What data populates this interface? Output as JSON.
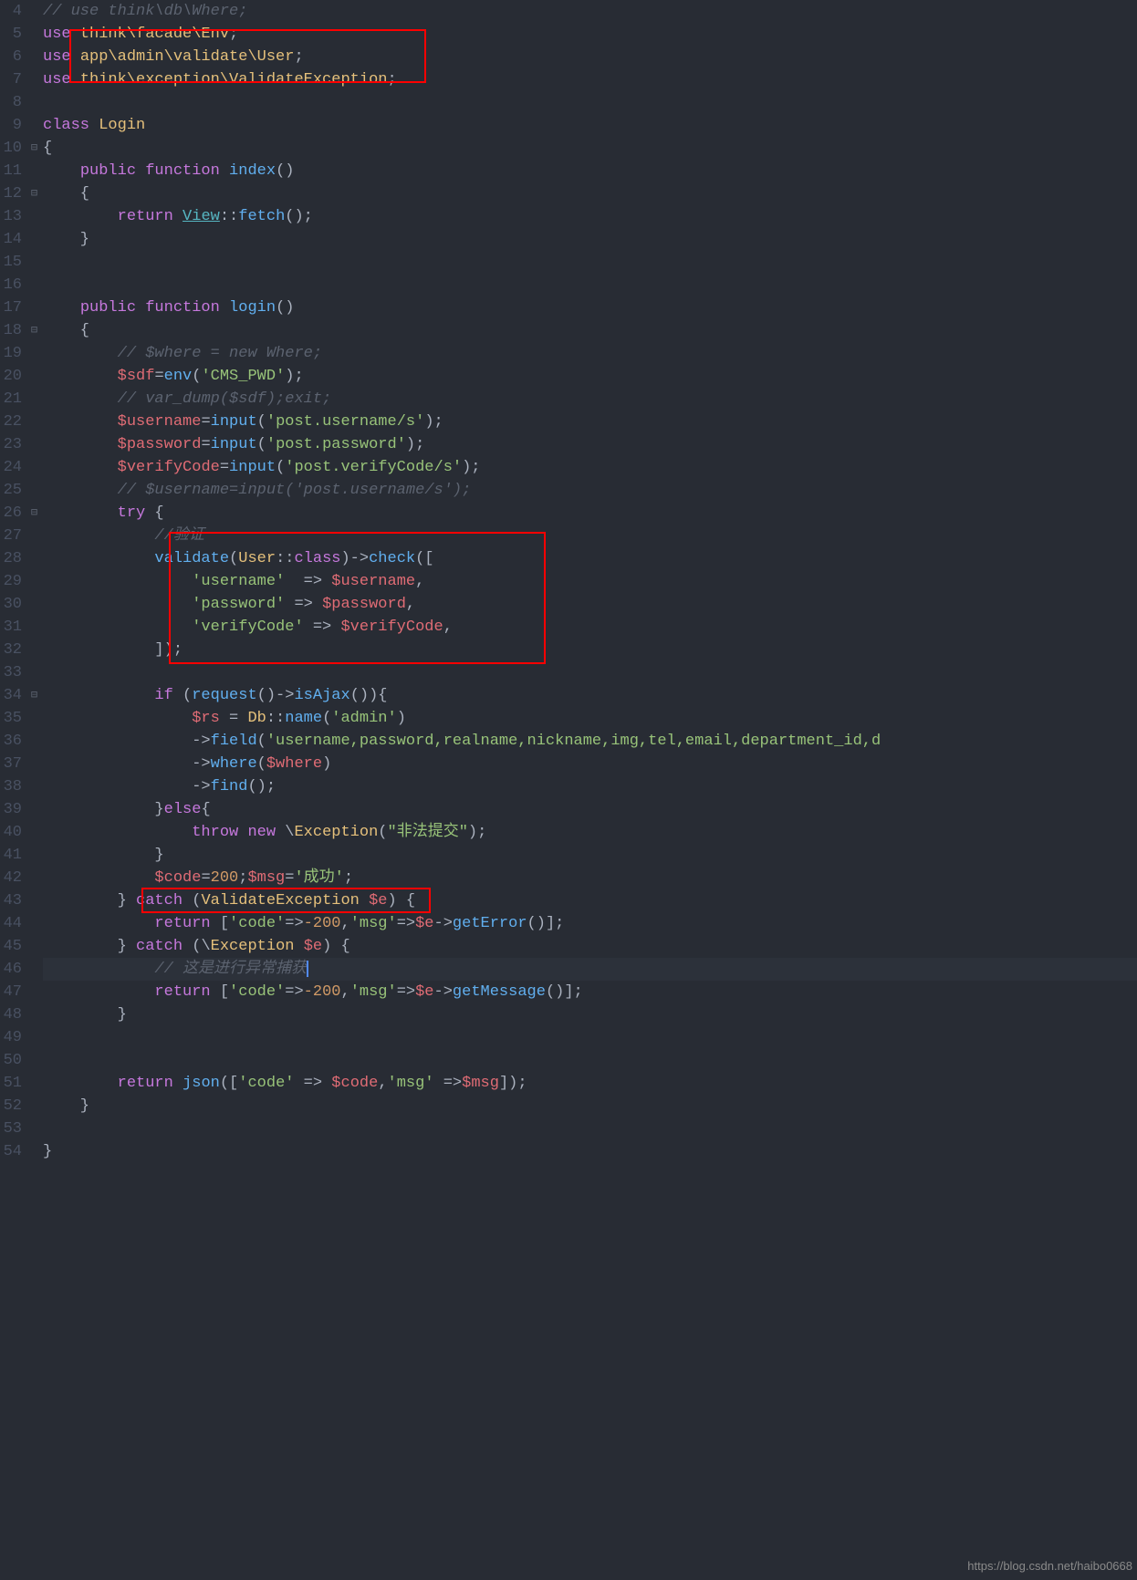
{
  "watermark": "https://blog.csdn.net/haibo0668",
  "lines": [
    {
      "n": "4",
      "fold": "",
      "t": [
        {
          "c": "com",
          "v": "// use think\\db\\Where;"
        }
      ]
    },
    {
      "n": "5",
      "fold": "",
      "t": [
        {
          "c": "kw",
          "v": "use "
        },
        {
          "c": "ns",
          "v": "think\\facade\\Env"
        },
        {
          "c": "pn",
          "v": ";"
        }
      ]
    },
    {
      "n": "6",
      "fold": "",
      "t": [
        {
          "c": "kw",
          "v": "use "
        },
        {
          "c": "ns",
          "v": "app\\admin\\validate\\User"
        },
        {
          "c": "pn",
          "v": ";"
        }
      ]
    },
    {
      "n": "7",
      "fold": "",
      "t": [
        {
          "c": "kw",
          "v": "use "
        },
        {
          "c": "ns",
          "v": "think\\exception\\ValidateException"
        },
        {
          "c": "pn",
          "v": ";"
        }
      ]
    },
    {
      "n": "8",
      "fold": "",
      "t": []
    },
    {
      "n": "9",
      "fold": "",
      "t": [
        {
          "c": "kw",
          "v": "class "
        },
        {
          "c": "cls",
          "v": "Login"
        }
      ]
    },
    {
      "n": "10",
      "fold": "⊟",
      "t": [
        {
          "c": "pn",
          "v": "{"
        }
      ]
    },
    {
      "n": "11",
      "fold": "",
      "t": [
        {
          "c": "pn",
          "v": "    "
        },
        {
          "c": "kw",
          "v": "public function "
        },
        {
          "c": "fn",
          "v": "index"
        },
        {
          "c": "pn",
          "v": "()"
        }
      ]
    },
    {
      "n": "12",
      "fold": "⊟",
      "t": [
        {
          "c": "pn",
          "v": "    {"
        }
      ]
    },
    {
      "n": "13",
      "fold": "",
      "t": [
        {
          "c": "pn",
          "v": "        "
        },
        {
          "c": "kw",
          "v": "return "
        },
        {
          "c": "lnk",
          "v": "View"
        },
        {
          "c": "pn",
          "v": "::"
        },
        {
          "c": "fn",
          "v": "fetch"
        },
        {
          "c": "pn",
          "v": "();"
        }
      ]
    },
    {
      "n": "14",
      "fold": "",
      "t": [
        {
          "c": "pn",
          "v": "    }"
        }
      ]
    },
    {
      "n": "15",
      "fold": "",
      "t": []
    },
    {
      "n": "16",
      "fold": "",
      "t": []
    },
    {
      "n": "17",
      "fold": "",
      "t": [
        {
          "c": "pn",
          "v": "    "
        },
        {
          "c": "kw",
          "v": "public function "
        },
        {
          "c": "fn",
          "v": "login"
        },
        {
          "c": "pn",
          "v": "()"
        }
      ]
    },
    {
      "n": "18",
      "fold": "⊟",
      "t": [
        {
          "c": "pn",
          "v": "    {"
        }
      ]
    },
    {
      "n": "19",
      "fold": "",
      "t": [
        {
          "c": "pn",
          "v": "        "
        },
        {
          "c": "com",
          "v": "// $where = new Where;"
        }
      ]
    },
    {
      "n": "20",
      "fold": "",
      "t": [
        {
          "c": "pn",
          "v": "        "
        },
        {
          "c": "var",
          "v": "$sdf"
        },
        {
          "c": "pn",
          "v": "="
        },
        {
          "c": "fn",
          "v": "env"
        },
        {
          "c": "pn",
          "v": "("
        },
        {
          "c": "str",
          "v": "'CMS_PWD'"
        },
        {
          "c": "pn",
          "v": ");"
        }
      ]
    },
    {
      "n": "21",
      "fold": "",
      "t": [
        {
          "c": "pn",
          "v": "        "
        },
        {
          "c": "com",
          "v": "// var_dump($sdf);exit;"
        }
      ]
    },
    {
      "n": "22",
      "fold": "",
      "t": [
        {
          "c": "pn",
          "v": "        "
        },
        {
          "c": "var",
          "v": "$username"
        },
        {
          "c": "pn",
          "v": "="
        },
        {
          "c": "fn",
          "v": "input"
        },
        {
          "c": "pn",
          "v": "("
        },
        {
          "c": "str",
          "v": "'post.username/s'"
        },
        {
          "c": "pn",
          "v": ");"
        }
      ]
    },
    {
      "n": "23",
      "fold": "",
      "t": [
        {
          "c": "pn",
          "v": "        "
        },
        {
          "c": "var",
          "v": "$password"
        },
        {
          "c": "pn",
          "v": "="
        },
        {
          "c": "fn",
          "v": "input"
        },
        {
          "c": "pn",
          "v": "("
        },
        {
          "c": "str",
          "v": "'post.password'"
        },
        {
          "c": "pn",
          "v": ");"
        }
      ]
    },
    {
      "n": "24",
      "fold": "",
      "t": [
        {
          "c": "pn",
          "v": "        "
        },
        {
          "c": "var",
          "v": "$verifyCode"
        },
        {
          "c": "pn",
          "v": "="
        },
        {
          "c": "fn",
          "v": "input"
        },
        {
          "c": "pn",
          "v": "("
        },
        {
          "c": "str",
          "v": "'post.verifyCode/s'"
        },
        {
          "c": "pn",
          "v": ");"
        }
      ]
    },
    {
      "n": "25",
      "fold": "",
      "t": [
        {
          "c": "pn",
          "v": "        "
        },
        {
          "c": "com",
          "v": "// $username=input('post.username/s');"
        }
      ]
    },
    {
      "n": "26",
      "fold": "⊟",
      "t": [
        {
          "c": "pn",
          "v": "        "
        },
        {
          "c": "kw",
          "v": "try"
        },
        {
          "c": "pn",
          "v": " {"
        }
      ]
    },
    {
      "n": "27",
      "fold": "",
      "t": [
        {
          "c": "pn",
          "v": "            "
        },
        {
          "c": "com",
          "v": "//验证"
        }
      ]
    },
    {
      "n": "28",
      "fold": "",
      "t": [
        {
          "c": "pn",
          "v": "            "
        },
        {
          "c": "fn",
          "v": "validate"
        },
        {
          "c": "pn",
          "v": "("
        },
        {
          "c": "cls",
          "v": "User"
        },
        {
          "c": "pn",
          "v": "::"
        },
        {
          "c": "kw",
          "v": "class"
        },
        {
          "c": "pn",
          "v": ")->"
        },
        {
          "c": "fn",
          "v": "check"
        },
        {
          "c": "pn",
          "v": "(["
        }
      ]
    },
    {
      "n": "29",
      "fold": "",
      "t": [
        {
          "c": "pn",
          "v": "                "
        },
        {
          "c": "str",
          "v": "'username'"
        },
        {
          "c": "pn",
          "v": "  => "
        },
        {
          "c": "var",
          "v": "$username"
        },
        {
          "c": "pn",
          "v": ","
        }
      ]
    },
    {
      "n": "30",
      "fold": "",
      "t": [
        {
          "c": "pn",
          "v": "                "
        },
        {
          "c": "str",
          "v": "'password'"
        },
        {
          "c": "pn",
          "v": " => "
        },
        {
          "c": "var",
          "v": "$password"
        },
        {
          "c": "pn",
          "v": ","
        }
      ]
    },
    {
      "n": "31",
      "fold": "",
      "t": [
        {
          "c": "pn",
          "v": "                "
        },
        {
          "c": "str",
          "v": "'verifyCode'"
        },
        {
          "c": "pn",
          "v": " => "
        },
        {
          "c": "var",
          "v": "$verifyCode"
        },
        {
          "c": "pn",
          "v": ","
        }
      ]
    },
    {
      "n": "32",
      "fold": "",
      "t": [
        {
          "c": "pn",
          "v": "            ]);"
        }
      ]
    },
    {
      "n": "33",
      "fold": "",
      "t": []
    },
    {
      "n": "34",
      "fold": "⊟",
      "t": [
        {
          "c": "pn",
          "v": "            "
        },
        {
          "c": "kw",
          "v": "if"
        },
        {
          "c": "pn",
          "v": " ("
        },
        {
          "c": "fn",
          "v": "request"
        },
        {
          "c": "pn",
          "v": "()->"
        },
        {
          "c": "fn",
          "v": "isAjax"
        },
        {
          "c": "pn",
          "v": "()){"
        }
      ]
    },
    {
      "n": "35",
      "fold": "",
      "t": [
        {
          "c": "pn",
          "v": "                "
        },
        {
          "c": "var",
          "v": "$rs"
        },
        {
          "c": "pn",
          "v": " = "
        },
        {
          "c": "cls",
          "v": "Db"
        },
        {
          "c": "pn",
          "v": "::"
        },
        {
          "c": "fn",
          "v": "name"
        },
        {
          "c": "pn",
          "v": "("
        },
        {
          "c": "str",
          "v": "'admin'"
        },
        {
          "c": "pn",
          "v": ")"
        }
      ]
    },
    {
      "n": "36",
      "fold": "",
      "t": [
        {
          "c": "pn",
          "v": "                ->"
        },
        {
          "c": "fn",
          "v": "field"
        },
        {
          "c": "pn",
          "v": "("
        },
        {
          "c": "str",
          "v": "'username,password,realname,nickname,img,tel,email,department_id,d"
        }
      ]
    },
    {
      "n": "37",
      "fold": "",
      "t": [
        {
          "c": "pn",
          "v": "                ->"
        },
        {
          "c": "fn",
          "v": "where"
        },
        {
          "c": "pn",
          "v": "("
        },
        {
          "c": "var",
          "v": "$where"
        },
        {
          "c": "pn",
          "v": ")"
        }
      ]
    },
    {
      "n": "38",
      "fold": "",
      "t": [
        {
          "c": "pn",
          "v": "                ->"
        },
        {
          "c": "fn",
          "v": "find"
        },
        {
          "c": "pn",
          "v": "();"
        }
      ]
    },
    {
      "n": "39",
      "fold": "",
      "t": [
        {
          "c": "pn",
          "v": "            }"
        },
        {
          "c": "kw",
          "v": "else"
        },
        {
          "c": "pn",
          "v": "{"
        }
      ]
    },
    {
      "n": "40",
      "fold": "",
      "t": [
        {
          "c": "pn",
          "v": "                "
        },
        {
          "c": "kw",
          "v": "throw new"
        },
        {
          "c": "pn",
          "v": " \\"
        },
        {
          "c": "cls",
          "v": "Exception"
        },
        {
          "c": "pn",
          "v": "("
        },
        {
          "c": "str",
          "v": "\"非法提交\""
        },
        {
          "c": "pn",
          "v": ");"
        }
      ]
    },
    {
      "n": "41",
      "fold": "",
      "t": [
        {
          "c": "pn",
          "v": "            }"
        }
      ]
    },
    {
      "n": "42",
      "fold": "",
      "t": [
        {
          "c": "pn",
          "v": "            "
        },
        {
          "c": "var",
          "v": "$code"
        },
        {
          "c": "pn",
          "v": "="
        },
        {
          "c": "num",
          "v": "200"
        },
        {
          "c": "pn",
          "v": ";"
        },
        {
          "c": "var",
          "v": "$msg"
        },
        {
          "c": "pn",
          "v": "="
        },
        {
          "c": "str",
          "v": "'成功'"
        },
        {
          "c": "pn",
          "v": ";"
        }
      ]
    },
    {
      "n": "43",
      "fold": "",
      "t": [
        {
          "c": "pn",
          "v": "        } "
        },
        {
          "c": "kw",
          "v": "catch"
        },
        {
          "c": "pn",
          "v": " ("
        },
        {
          "c": "cls",
          "v": "ValidateException"
        },
        {
          "c": "pn",
          "v": " "
        },
        {
          "c": "var",
          "v": "$e"
        },
        {
          "c": "pn",
          "v": ") {"
        }
      ]
    },
    {
      "n": "44",
      "fold": "",
      "t": [
        {
          "c": "pn",
          "v": "            "
        },
        {
          "c": "kw",
          "v": "return"
        },
        {
          "c": "pn",
          "v": " ["
        },
        {
          "c": "str",
          "v": "'code'"
        },
        {
          "c": "pn",
          "v": "=>"
        },
        {
          "c": "num",
          "v": "-200"
        },
        {
          "c": "pn",
          "v": ","
        },
        {
          "c": "str",
          "v": "'msg'"
        },
        {
          "c": "pn",
          "v": "=>"
        },
        {
          "c": "var",
          "v": "$e"
        },
        {
          "c": "pn",
          "v": "->"
        },
        {
          "c": "fn",
          "v": "getError"
        },
        {
          "c": "pn",
          "v": "()];"
        }
      ]
    },
    {
      "n": "45",
      "fold": "",
      "t": [
        {
          "c": "pn",
          "v": "        } "
        },
        {
          "c": "kw",
          "v": "catch"
        },
        {
          "c": "pn",
          "v": " (\\"
        },
        {
          "c": "cls",
          "v": "Exception"
        },
        {
          "c": "pn",
          "v": " "
        },
        {
          "c": "var",
          "v": "$e"
        },
        {
          "c": "pn",
          "v": ") {"
        }
      ]
    },
    {
      "n": "46",
      "fold": "",
      "hl": true,
      "cursor": true,
      "t": [
        {
          "c": "pn",
          "v": "            "
        },
        {
          "c": "com",
          "v": "// 这是进行异常捕获"
        }
      ]
    },
    {
      "n": "47",
      "fold": "",
      "t": [
        {
          "c": "pn",
          "v": "            "
        },
        {
          "c": "kw",
          "v": "return"
        },
        {
          "c": "pn",
          "v": " ["
        },
        {
          "c": "str",
          "v": "'code'"
        },
        {
          "c": "pn",
          "v": "=>"
        },
        {
          "c": "num",
          "v": "-200"
        },
        {
          "c": "pn",
          "v": ","
        },
        {
          "c": "str",
          "v": "'msg'"
        },
        {
          "c": "pn",
          "v": "=>"
        },
        {
          "c": "var",
          "v": "$e"
        },
        {
          "c": "pn",
          "v": "->"
        },
        {
          "c": "fn",
          "v": "getMessage"
        },
        {
          "c": "pn",
          "v": "()];"
        }
      ]
    },
    {
      "n": "48",
      "fold": "",
      "t": [
        {
          "c": "pn",
          "v": "        }"
        }
      ]
    },
    {
      "n": "49",
      "fold": "",
      "t": []
    },
    {
      "n": "50",
      "fold": "",
      "t": []
    },
    {
      "n": "51",
      "fold": "",
      "t": [
        {
          "c": "pn",
          "v": "        "
        },
        {
          "c": "kw",
          "v": "return"
        },
        {
          "c": "pn",
          "v": " "
        },
        {
          "c": "fn",
          "v": "json"
        },
        {
          "c": "pn",
          "v": "(["
        },
        {
          "c": "str",
          "v": "'code'"
        },
        {
          "c": "pn",
          "v": " => "
        },
        {
          "c": "var",
          "v": "$code"
        },
        {
          "c": "pn",
          "v": ","
        },
        {
          "c": "str",
          "v": "'msg'"
        },
        {
          "c": "pn",
          "v": " =>"
        },
        {
          "c": "var",
          "v": "$msg"
        },
        {
          "c": "pn",
          "v": "]);"
        }
      ]
    },
    {
      "n": "52",
      "fold": "",
      "t": [
        {
          "c": "pn",
          "v": "    }"
        }
      ]
    },
    {
      "n": "53",
      "fold": "",
      "t": []
    },
    {
      "n": "54",
      "fold": "",
      "t": [
        {
          "c": "pn",
          "v": "}"
        }
      ]
    }
  ]
}
